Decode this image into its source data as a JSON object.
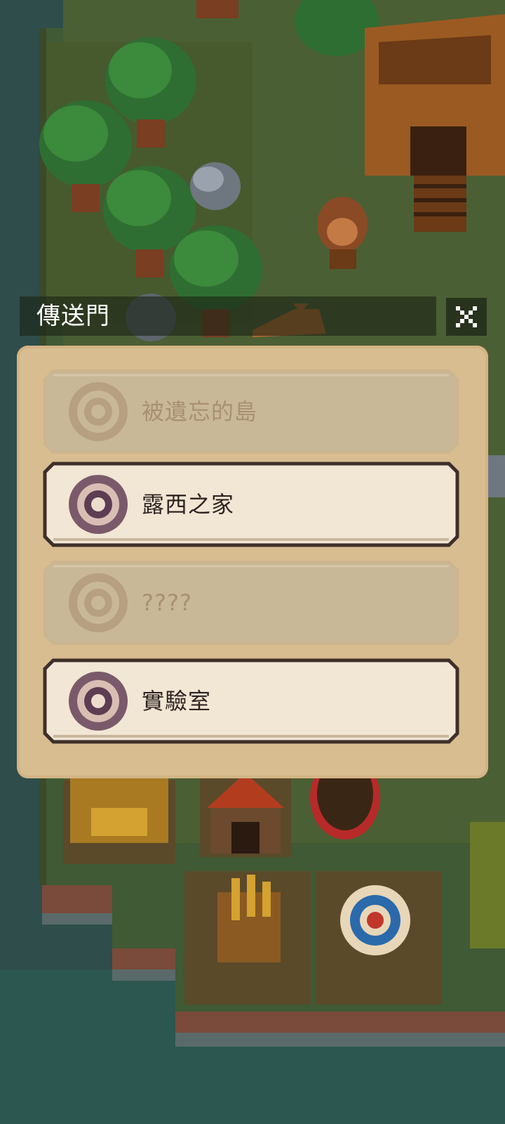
{
  "dialog": {
    "title": "傳送門",
    "close_icon": "close-x-icon"
  },
  "teleport_options": [
    {
      "label": "被遺忘的島",
      "state": "disabled",
      "icon": "portal-ring-icon"
    },
    {
      "label": "露西之家",
      "state": "enabled",
      "icon": "portal-ring-icon"
    },
    {
      "label": "????",
      "state": "disabled",
      "icon": "portal-ring-icon"
    },
    {
      "label": "實驗室",
      "state": "enabled",
      "icon": "portal-ring-icon"
    }
  ],
  "colors": {
    "panel": "#d8bd90",
    "option_enabled": "#f2e6d5",
    "option_disabled": "#c8b897",
    "ring_enabled": "#7a5a6a",
    "ring_disabled": "#b79f82"
  }
}
